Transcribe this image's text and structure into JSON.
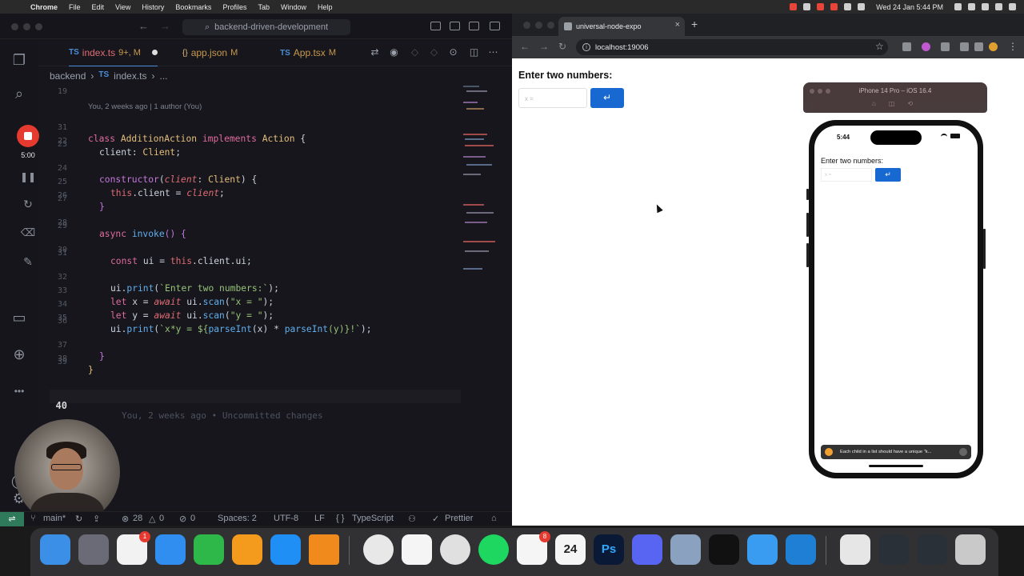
{
  "menubar": {
    "app": "Chrome",
    "items": [
      "File",
      "Edit",
      "View",
      "History",
      "Bookmarks",
      "Profiles",
      "Tab",
      "Window",
      "Help"
    ],
    "datetime": "Wed 24 Jan  5:44 PM"
  },
  "vscode": {
    "search": "backend-driven-development",
    "tabs": [
      {
        "icon": "TS",
        "label": "index.ts",
        "status": "9+, M"
      },
      {
        "icon": "{}",
        "label": "app.json",
        "status": "M"
      },
      {
        "icon": "TS",
        "label": "App.tsx",
        "status": "M"
      }
    ],
    "breadcrumb": {
      "folder": "backend",
      "icon": "TS",
      "file": "index.ts",
      "more": "..."
    },
    "recording_time": "5:00",
    "blame_top": "You, 2 weeks ago | 1 author (You)",
    "ghost_text": "You, 2 weeks ago • Uncommitted changes",
    "line_numbers": [
      "19",
      "31",
      "22",
      "23",
      "24",
      "25",
      "26",
      "27",
      "28",
      "29",
      "30",
      "31",
      "32",
      "33",
      "34",
      "35",
      "36",
      "37",
      "38",
      "39",
      "40"
    ],
    "code": {
      "l1a": "class",
      "l1b": "AdditionAction",
      "l1c": "implements",
      "l1d": "Action",
      "l1e": "{",
      "l2a": "client",
      "l2b": ": ",
      "l2c": "Client",
      "l2d": ";",
      "l3a": "constructor",
      "l3b": "(",
      "l3c": "client",
      "l3d": ": ",
      "l3e": "Client",
      "l3f": ") {",
      "l4a": "this",
      "l4b": ".client = ",
      "l4c": "client",
      "l4d": ";",
      "l5": "}",
      "l6a": "async",
      "l6b": "invoke",
      "l6c": "() {",
      "l7a": "const",
      "l7b": " ui = ",
      "l7c": "this",
      "l7d": ".client.ui;",
      "l8a": "ui.",
      "l8b": "print",
      "l8c": "(",
      "l8d": "`Enter two numbers:`",
      "l8e": ");",
      "l9a": "let",
      "l9b": " x = ",
      "l9c": "await",
      "l9d": " ui.",
      "l9e": "scan",
      "l9f": "(",
      "l9g": "\"x = \"",
      "l9h": ");",
      "l10a": "let",
      "l10b": " y = ",
      "l10c": "await",
      "l10d": " ui.",
      "l10e": "scan",
      "l10f": "(",
      "l10g": "\"y = \"",
      "l10h": ");",
      "l11a": "ui.",
      "l11b": "print",
      "l11c": "(",
      "l11d": "`x*y = ${",
      "l11e": "parseInt",
      "l11f": "(x) * ",
      "l11g": "parseInt",
      "l11h": "(y)}!`",
      "l11i": ");",
      "l12": "}",
      "l13": "}"
    },
    "status": {
      "branch": "main*",
      "problems": "28",
      "warnings": "0",
      "ports": "0",
      "spaces": "Spaces: 2",
      "encoding": "UTF-8",
      "eol": "LF",
      "language": "TypeScript",
      "formatter": "Prettier"
    }
  },
  "chrome": {
    "tab_title": "universal-node-expo",
    "url": "localhost:19006",
    "page": {
      "heading": "Enter two numbers:",
      "input_placeholder": "x =",
      "submit_glyph": "↵"
    }
  },
  "simulator": {
    "title": "iPhone 14 Pro – iOS 16.4",
    "time": "5:44",
    "heading": "Enter two numbers:",
    "input_placeholder": "x =",
    "submit_glyph": "↵",
    "toast": "Each child in a list should have a unique \"k..."
  },
  "dock": {
    "slack_badge": "8",
    "photos_badge": "1",
    "calendar_day": "24",
    "photoshop_label": "Ps"
  },
  "colors": {
    "vscode_bg": "#16161c",
    "accent_blue": "#1769d1",
    "record_red": "#e53a2f"
  }
}
